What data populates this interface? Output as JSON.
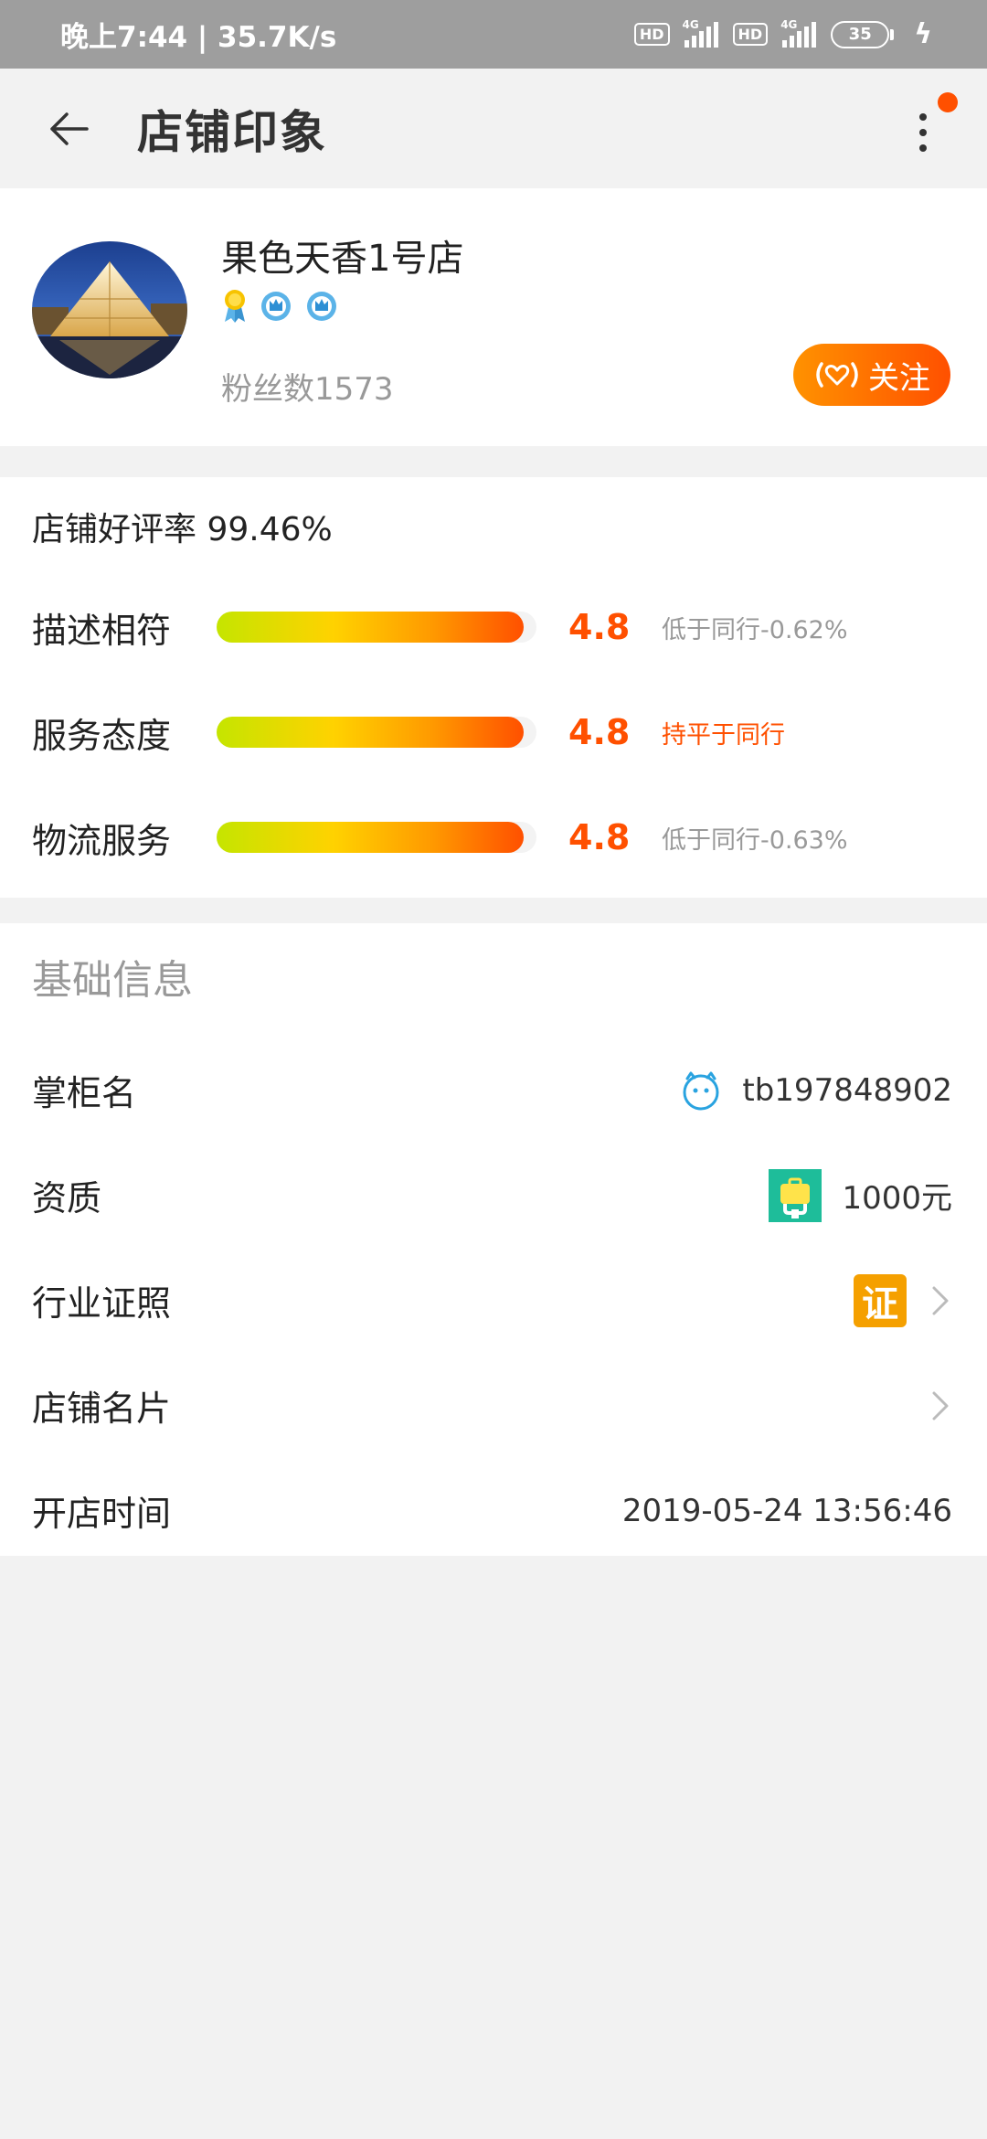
{
  "status_bar": {
    "time": "晚上7:44 | 35.7K/s",
    "hd1": "HD",
    "net1": "4G",
    "hd2": "HD",
    "net2": "4G",
    "battery": "35"
  },
  "header": {
    "title": "店铺印象"
  },
  "shop": {
    "name": "果色天香1号店",
    "fans_label": "粉丝数",
    "fans_count": "1573",
    "follow_label": "关注"
  },
  "ratings": {
    "good_rate_label": "店铺好评率",
    "good_rate_value": "99.46%",
    "rows": [
      {
        "label": "描述相符",
        "score": "4.8",
        "compare": "低于同行-0.62%",
        "fill": 0.96
      },
      {
        "label": "服务态度",
        "score": "4.8",
        "compare": "持平于同行",
        "fill": 0.96
      },
      {
        "label": "物流服务",
        "score": "4.8",
        "compare": "低于同行-0.63%",
        "fill": 0.96
      }
    ]
  },
  "basic_info": {
    "heading": "基础信息",
    "owner_label": "掌柜名",
    "owner_value": "tb197848902",
    "qualification_label": "资质",
    "qualification_value": "1000元",
    "license_label": "行业证照",
    "license_badge": "证",
    "card_label": "店铺名片",
    "open_time_label": "开店时间",
    "open_time_value": "2019-05-24 13:56:46"
  },
  "colors": {
    "accent": "#ff5000",
    "follow_gradient_start": "#ff9200",
    "license_badge": "#f5a000",
    "qualification_icon": "#1ebd9a",
    "owner_icon": "#29a3e0"
  }
}
